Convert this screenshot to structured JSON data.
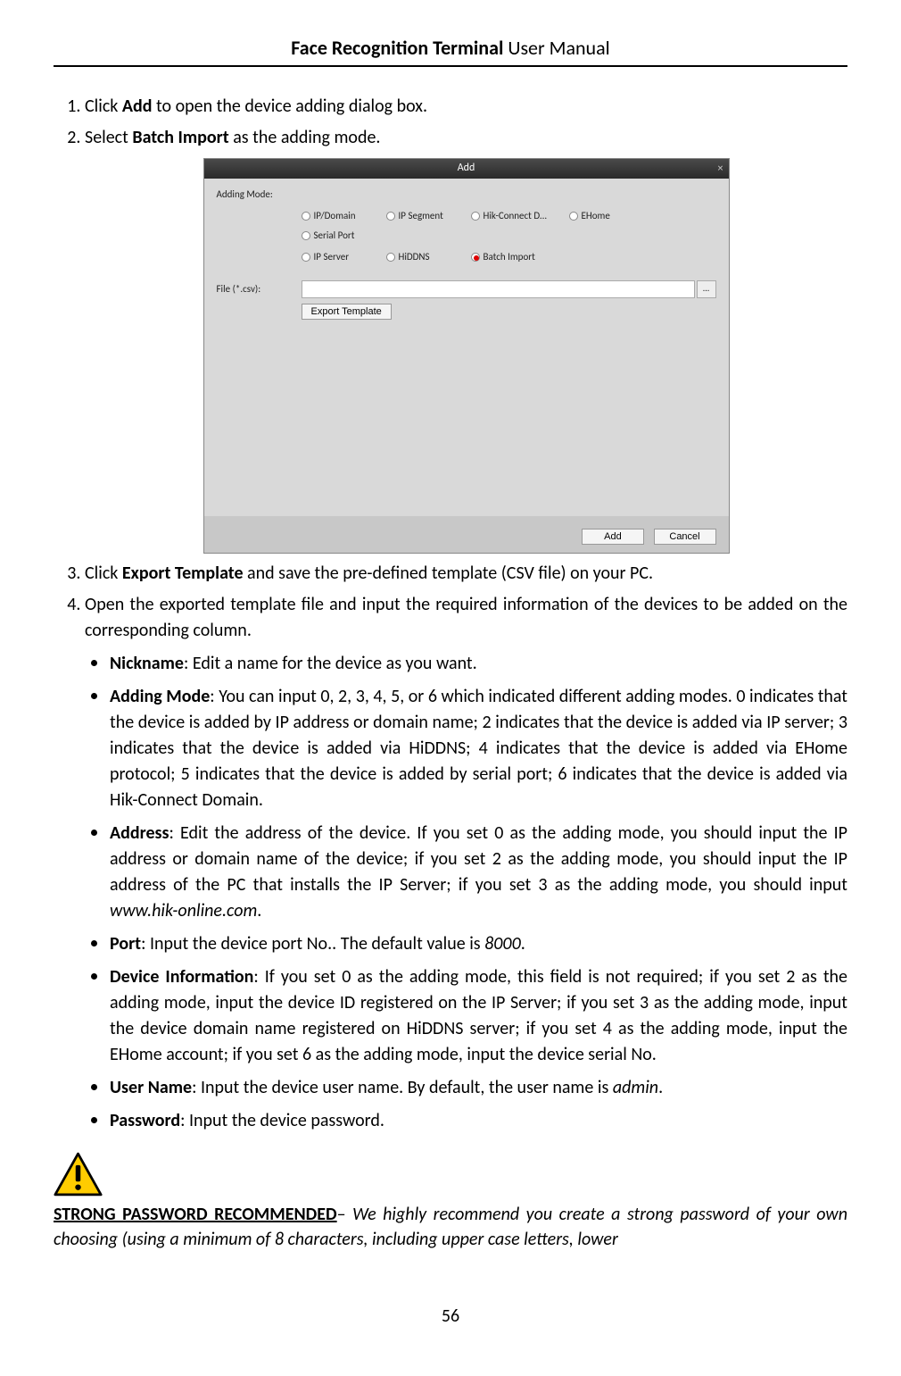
{
  "header": {
    "title_bold": "Face Recognition Terminal",
    "title_light": " User Manual"
  },
  "steps": {
    "s1_a": "Click ",
    "s1_bold": "Add",
    "s1_b": " to open the device adding dialog box.",
    "s2_a": "Select ",
    "s2_bold": "Batch Import",
    "s2_b": " as the adding mode.",
    "s3_a": "Click ",
    "s3_bold": "Export Template",
    "s3_b": " and save the pre-defined template (CSV file) on your PC.",
    "s4": "Open the exported template file and input the required information of the devices to be added on the corresponding column."
  },
  "dialog": {
    "title": "Add",
    "close": "×",
    "mode_label": "Adding Mode:",
    "radios": {
      "r1": "IP/Domain",
      "r2": "IP Segment",
      "r3": "Hik-Connect D...",
      "r4": "EHome",
      "r5": "Serial Port",
      "r6": "IP Server",
      "r7": "HiDDNS",
      "r8": "Batch Import"
    },
    "file_label": "File (*.csv):",
    "browse": "...",
    "export_btn": "Export Template",
    "add_btn": "Add",
    "cancel_btn": "Cancel"
  },
  "bullets": {
    "nickname_label": "Nickname",
    "nickname_text": ": Edit a name for the device as you want.",
    "adding_label": "Adding Mode",
    "adding_text": ": You can input 0, 2, 3, 4, 5, or 6 which indicated different adding modes. 0 indicates that the device is added by IP address or domain name; 2 indicates that the device is added via IP server; 3 indicates that the device is added via HiDDNS; 4 indicates that the device is added via EHome protocol; 5 indicates that the device is added by serial port; 6 indicates that the device is added via Hik-Connect Domain.",
    "address_label": "Address",
    "address_text_a": ": Edit the address of the device. If you set 0 as the adding mode, you should input the IP address or domain name of the device; if you set 2 as the adding mode, you should input the IP address of the PC that installs the IP Server; if you set 3 as the adding mode, you should input ",
    "address_italic": "www.hik-online.com",
    "address_text_b": ".",
    "port_label": "Port",
    "port_text_a": ": Input the device port No.. The default value is ",
    "port_italic": "8000",
    "port_text_b": ".",
    "devinfo_label": "Device Information",
    "devinfo_text": ": If you set 0 as the adding mode, this field is not required; if you set 2 as the adding mode, input the device ID registered on the IP Server; if you set 3 as the adding mode, input the device domain name registered on HiDDNS server; if you set 4 as the adding mode, input the EHome account; if you set 6 as the adding mode, input the device serial No.",
    "username_label": "User Name",
    "username_text_a": ": Input the device user name. By default, the user name is ",
    "username_italic": "admin",
    "username_text_b": ".",
    "password_label": "Password",
    "password_text": ": Input the device password."
  },
  "warning": {
    "title": "STRONG PASSWORD RECOMMENDED",
    "dash": "– ",
    "body": "We highly recommend you create a strong password of your own choosing (using a minimum of 8 characters, including upper case letters, lower"
  },
  "page_number": "56"
}
